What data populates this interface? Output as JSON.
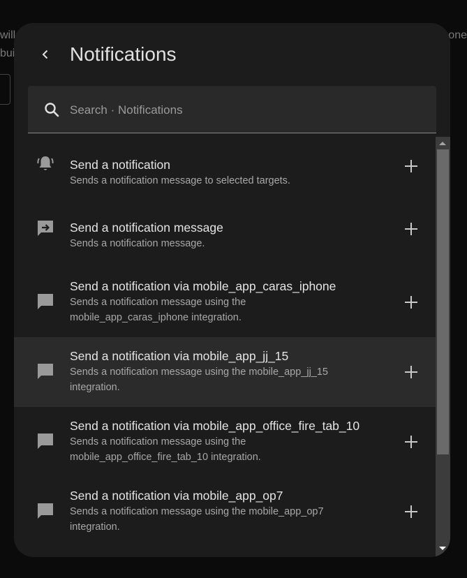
{
  "background": {
    "left_line1": "will h",
    "left_line2": "bui",
    "right_line1": "one"
  },
  "dialog": {
    "title": "Notifications",
    "back_icon": "chevron-left-icon"
  },
  "search": {
    "placeholder": "Search · Notifications",
    "value": "",
    "icon": "search-icon"
  },
  "items": [
    {
      "title": "Send a notification",
      "description": "Sends a notification message to selected targets.",
      "icon": "bell-ring-icon"
    },
    {
      "title": "Send a notification message",
      "description": "Sends a notification message.",
      "icon": "message-arrow-icon"
    },
    {
      "title": "Send a notification via mobile_app_caras_iphone",
      "description": "Sends a notification message using the mobile_app_caras_iphone integration.",
      "icon": "message-icon"
    },
    {
      "title": "Send a notification via mobile_app_jj_15",
      "description": "Sends a notification message using the mobile_app_jj_15 integration.",
      "icon": "message-icon"
    },
    {
      "title": "Send a notification via mobile_app_office_fire_tab_10",
      "description": "Sends a notification message using the mobile_app_office_fire_tab_10 integration.",
      "icon": "message-icon"
    },
    {
      "title": "Send a notification via mobile_app_op7",
      "description": "Sends a notification message using the mobile_app_op7 integration.",
      "icon": "message-icon"
    }
  ],
  "colors": {
    "dialog_bg": "#1c1c1c",
    "hover_row": "#2b2b2b",
    "icon": "#9a9a9a"
  }
}
